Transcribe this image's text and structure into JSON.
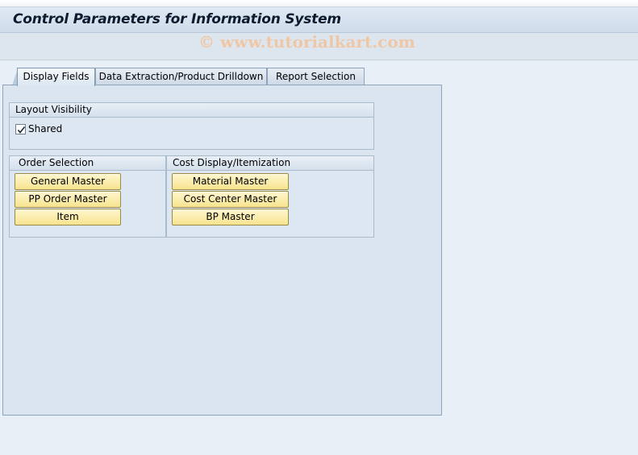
{
  "window": {
    "title": "Control Parameters for Information System",
    "watermark": "© www.tutorialkart.com"
  },
  "tabs": [
    {
      "label": "Display Fields",
      "active": true
    },
    {
      "label": "Data Extraction/Product Drilldown",
      "active": false
    },
    {
      "label": "Report Selection",
      "active": false
    }
  ],
  "layout_visibility": {
    "header": "Layout Visibility",
    "shared_label": "Shared",
    "shared_checked": true
  },
  "order_selection": {
    "header": "Order Selection",
    "buttons": [
      "General Master",
      "PP Order Master",
      "Item"
    ]
  },
  "cost_display": {
    "header": "Cost Display/Itemization",
    "buttons": [
      "Material Master",
      "Cost Center Master",
      "BP Master"
    ]
  },
  "colors": {
    "button_fill": "#f7e38e",
    "background": "#e8eff6"
  }
}
